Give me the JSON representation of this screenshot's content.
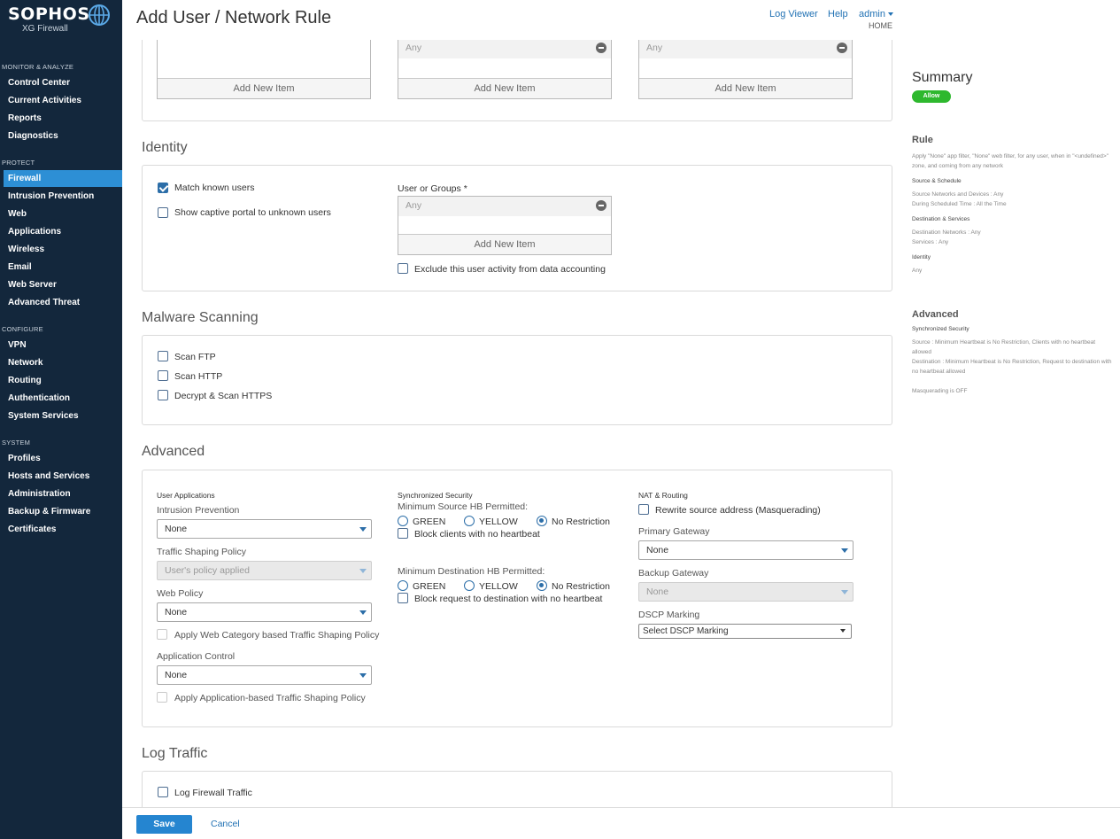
{
  "brand": {
    "name": "SOPHOS",
    "product": "XG Firewall"
  },
  "nav": {
    "monitor_head": "MONITOR & ANALYZE",
    "monitor": [
      "Control Center",
      "Current Activities",
      "Reports",
      "Diagnostics"
    ],
    "protect_head": "PROTECT",
    "protect": [
      "Firewall",
      "Intrusion Prevention",
      "Web",
      "Applications",
      "Wireless",
      "Email",
      "Web Server",
      "Advanced Threat"
    ],
    "configure_head": "CONFIGURE",
    "configure": [
      "VPN",
      "Network",
      "Routing",
      "Authentication",
      "System Services"
    ],
    "system_head": "SYSTEM",
    "system": [
      "Profiles",
      "Hosts and Services",
      "Administration",
      "Backup & Firmware",
      "Certificates"
    ],
    "active": "Firewall"
  },
  "header": {
    "title": "Add User / Network Rule",
    "log_viewer": "Log Viewer",
    "help": "Help",
    "user": "admin",
    "home": "HOME"
  },
  "top_lists": {
    "any": "Any",
    "add": "Add New Item"
  },
  "identity": {
    "title": "Identity",
    "match_known": "Match known users",
    "captive": "Show captive portal to unknown users",
    "users_label": "User or Groups *",
    "users_value": "Any",
    "add": "Add New Item",
    "exclude": "Exclude this user activity from data accounting"
  },
  "malware": {
    "title": "Malware Scanning",
    "ftp": "Scan FTP",
    "http": "Scan HTTP",
    "https": "Decrypt & Scan HTTPS"
  },
  "advanced": {
    "title": "Advanced",
    "user_apps_head": "User Applications",
    "ips_label": "Intrusion Prevention",
    "ips_value": "None",
    "tsp_label": "Traffic Shaping Policy",
    "tsp_value": "User's policy applied",
    "web_label": "Web Policy",
    "web_value": "None",
    "web_cat": "Apply Web Category based Traffic Shaping Policy",
    "app_label": "Application Control",
    "app_value": "None",
    "app_tsp": "Apply Application-based Traffic Shaping Policy",
    "sync_head": "Synchronized Security",
    "min_src": "Minimum Source HB Permitted:",
    "green": "GREEN",
    "yellow": "YELLOW",
    "norestrict": "No Restriction",
    "block_clients": "Block clients with no heartbeat",
    "min_dst": "Minimum Destination HB Permitted:",
    "block_request": "Block request to destination with no heartbeat",
    "nat_head": "NAT & Routing",
    "masq": "Rewrite source address (Masquerading)",
    "primary_label": "Primary Gateway",
    "primary_value": "None",
    "backup_label": "Backup Gateway",
    "backup_value": "None",
    "dscp_label": "DSCP Marking",
    "dscp_value": "Select DSCP Marking"
  },
  "log": {
    "title": "Log Traffic",
    "fw": "Log Firewall Traffic"
  },
  "summary": {
    "title": "Summary",
    "badge": "Allow",
    "rule_head": "Rule",
    "rule_text": "Apply \"None\" app filter, \"None\" web filter, for any user, when in \"<undefined>\" zone, and coming from any network",
    "src_head": "Source & Schedule",
    "src_text1": "Source Networks and Devices : Any",
    "src_text2": "During Scheduled Time : All the Time",
    "dst_head": "Destination & Services",
    "dst_text1": "Destination Networks : Any",
    "dst_text2": "Services : Any",
    "id_head": "Identity",
    "id_text": "Any",
    "adv_head": "Advanced",
    "sync_head": "Synchronized Security",
    "sync_src": "Source : Minimum Heartbeat is No Restriction, Clients with no heartbeat allowed",
    "sync_dst": "Destination : Minimum Heartbeat is No Restriction, Request to destination with no heartbeat allowed",
    "masq": "Masquerading is OFF"
  },
  "footer": {
    "save": "Save",
    "cancel": "Cancel"
  }
}
